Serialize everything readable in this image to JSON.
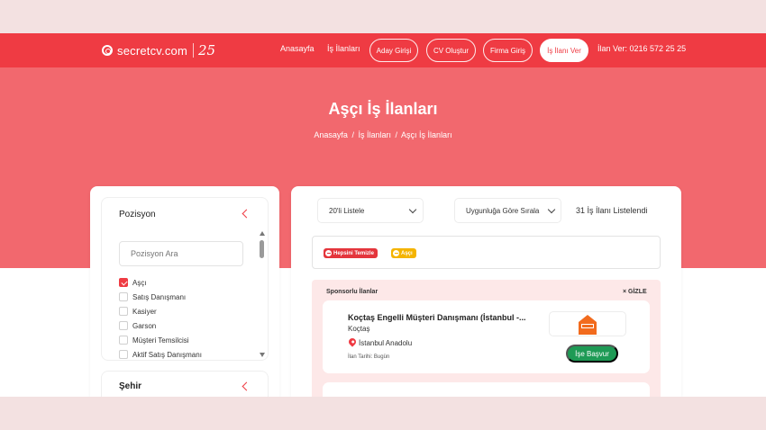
{
  "brand": {
    "name": "secretcv.com",
    "anniversary": "25"
  },
  "nav": {
    "home": "Anasayfa",
    "jobs": "İş İlanları",
    "candidate_login": "Aday Girişi",
    "create_cv": "CV Oluştur",
    "company_login": "Firma Giriş",
    "post_job": "İş İlanı Ver",
    "phone": "İlan Ver: 0216 572 25 25"
  },
  "hero": {
    "title": "Aşçı İş İlanları",
    "breadcrumb": [
      "Anasayfa",
      "İş İlanları",
      "Aşçı İş İlanları"
    ],
    "separator": "/"
  },
  "filters": {
    "position": {
      "title": "Pozisyon",
      "search_placeholder": "Pozisyon Ara",
      "options": [
        {
          "label": "Aşçı",
          "checked": true
        },
        {
          "label": "Satış Danışmanı",
          "checked": false
        },
        {
          "label": "Kasiyer",
          "checked": false
        },
        {
          "label": "Garson",
          "checked": false
        },
        {
          "label": "Müşteri Temsilcisi",
          "checked": false
        },
        {
          "label": "Aktif Satış Danışmanı",
          "checked": false
        }
      ]
    },
    "city": {
      "title": "Şehir"
    }
  },
  "listing": {
    "page_size": "20'li Listele",
    "sort": "Uygunluğa Göre Sırala",
    "count_text": "31 İş İlanı Listelendi",
    "tags": {
      "clear_all": "Hepsini Temizle",
      "active": "Aşçı"
    },
    "sponsored": {
      "label": "Sponsorlu İlanlar",
      "hide": "× GİZLE",
      "jobs": [
        {
          "title": "Koçtaş Engelli Müşteri Danışmanı (İstanbul -...",
          "company": "Koçtaş",
          "location": "İstanbul Anadolu",
          "date": "İlan Tarihi: Bugün",
          "apply": "İşe Başvur"
        }
      ]
    }
  },
  "colors": {
    "primary": "#ef3b43",
    "hero": "#f2686e",
    "apply": "#1e9a55",
    "tag_active": "#f4b400",
    "logo_orange": "#f26b1d"
  }
}
